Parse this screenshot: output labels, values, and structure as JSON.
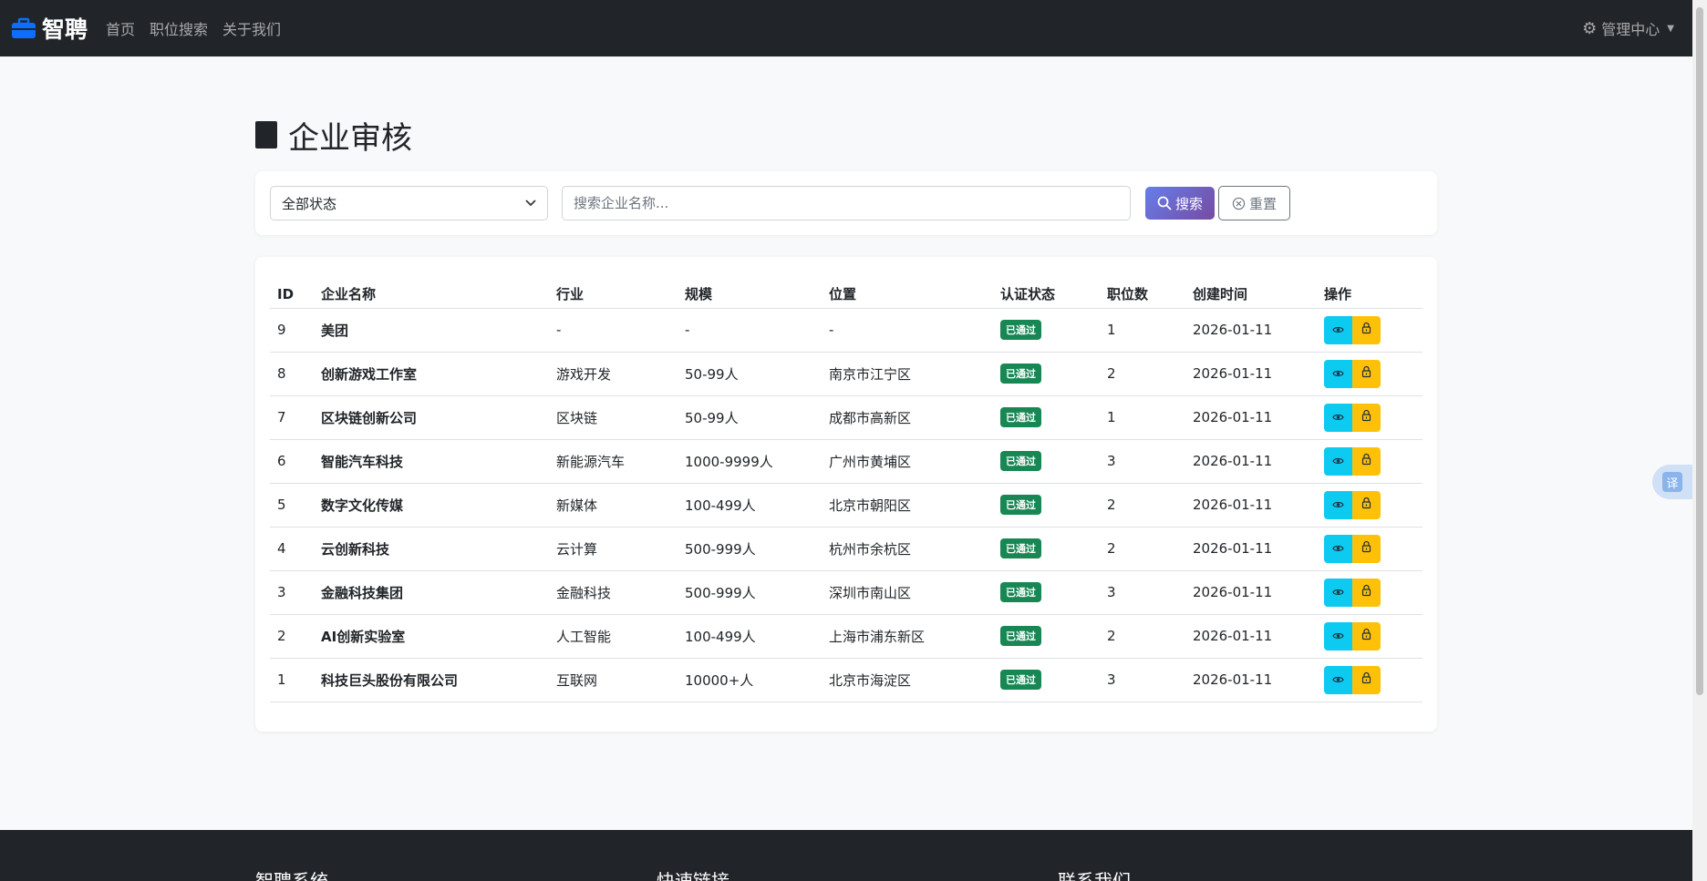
{
  "navbar": {
    "brand": "智聘",
    "links": [
      "首页",
      "职位搜索",
      "关于我们"
    ],
    "admin_label": "管理中心"
  },
  "page": {
    "title": "企业审核"
  },
  "filter": {
    "status_select": "全部状态",
    "search_placeholder": "搜索企业名称...",
    "search_button": "搜索",
    "reset_button": "重置"
  },
  "table": {
    "headers": [
      "ID",
      "企业名称",
      "行业",
      "规模",
      "位置",
      "认证状态",
      "职位数",
      "创建时间",
      "操作"
    ],
    "rows": [
      {
        "id": "9",
        "name": "美团",
        "industry": "-",
        "size": "-",
        "location": "-",
        "status": "已通过",
        "jobs": "1",
        "created": "2026-01-11"
      },
      {
        "id": "8",
        "name": "创新游戏工作室",
        "industry": "游戏开发",
        "size": "50-99人",
        "location": "南京市江宁区",
        "status": "已通过",
        "jobs": "2",
        "created": "2026-01-11"
      },
      {
        "id": "7",
        "name": "区块链创新公司",
        "industry": "区块链",
        "size": "50-99人",
        "location": "成都市高新区",
        "status": "已通过",
        "jobs": "1",
        "created": "2026-01-11"
      },
      {
        "id": "6",
        "name": "智能汽车科技",
        "industry": "新能源汽车",
        "size": "1000-9999人",
        "location": "广州市黄埔区",
        "status": "已通过",
        "jobs": "3",
        "created": "2026-01-11"
      },
      {
        "id": "5",
        "name": "数字文化传媒",
        "industry": "新媒体",
        "size": "100-499人",
        "location": "北京市朝阳区",
        "status": "已通过",
        "jobs": "2",
        "created": "2026-01-11"
      },
      {
        "id": "4",
        "name": "云创新科技",
        "industry": "云计算",
        "size": "500-999人",
        "location": "杭州市余杭区",
        "status": "已通过",
        "jobs": "2",
        "created": "2026-01-11"
      },
      {
        "id": "3",
        "name": "金融科技集团",
        "industry": "金融科技",
        "size": "500-999人",
        "location": "深圳市南山区",
        "status": "已通过",
        "jobs": "3",
        "created": "2026-01-11"
      },
      {
        "id": "2",
        "name": "AI创新实验室",
        "industry": "人工智能",
        "size": "100-499人",
        "location": "上海市浦东新区",
        "status": "已通过",
        "jobs": "2",
        "created": "2026-01-11"
      },
      {
        "id": "1",
        "name": "科技巨头股份有限公司",
        "industry": "互联网",
        "size": "10000+人",
        "location": "北京市海淀区",
        "status": "已通过",
        "jobs": "3",
        "created": "2026-01-11"
      }
    ]
  },
  "translate_label": "译",
  "footer": {
    "col1": "智聘系统",
    "col2": "快速链接",
    "col3": "联系我们"
  },
  "colors": {
    "navbar_bg": "#212529",
    "badge_success": "#198754",
    "view_btn": "#0dcaf0",
    "lock_btn": "#ffc107"
  }
}
